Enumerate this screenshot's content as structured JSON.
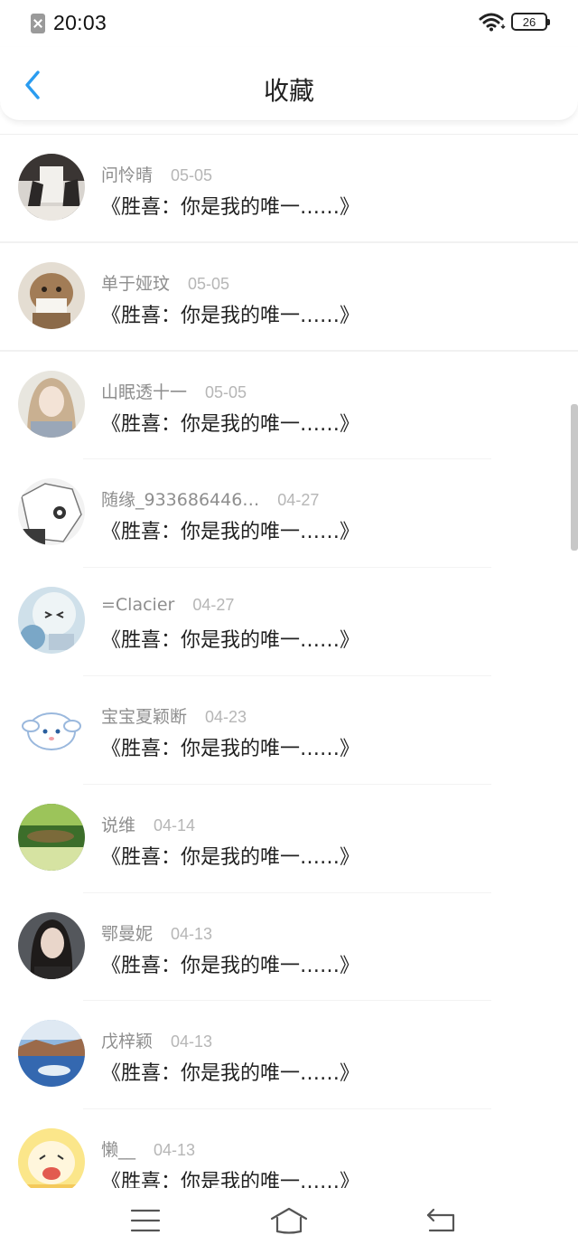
{
  "status_bar": {
    "time": "20:03",
    "battery": "26"
  },
  "header": {
    "title": "收藏",
    "back_icon": "chevron-left-icon",
    "accent_color": "#2a9cf0"
  },
  "favorites": [
    {
      "username": "问怜晴",
      "date": "05-05",
      "title": "《胜喜：你是我的唯一……》"
    },
    {
      "username": "单于娅玟",
      "date": "05-05",
      "title": "《胜喜：你是我的唯一……》"
    },
    {
      "username": "山眠透十一",
      "date": "05-05",
      "title": "《胜喜：你是我的唯一……》"
    },
    {
      "username": "随缘_933686446…",
      "date": "04-27",
      "title": "《胜喜：你是我的唯一……》"
    },
    {
      "username": "=Clacier",
      "date": "04-27",
      "title": "《胜喜：你是我的唯一……》"
    },
    {
      "username": "宝宝夏颖断",
      "date": "04-23",
      "title": "《胜喜：你是我的唯一……》"
    },
    {
      "username": "说维",
      "date": "04-14",
      "title": "《胜喜：你是我的唯一……》"
    },
    {
      "username": "鄂曼妮",
      "date": "04-13",
      "title": "《胜喜：你是我的唯一……》"
    },
    {
      "username": "戊梓颖",
      "date": "04-13",
      "title": "《胜喜：你是我的唯一……》"
    },
    {
      "username": "懒__",
      "date": "04-13",
      "title": "《胜喜：你是我的唯一……》"
    }
  ],
  "bottom_nav": {
    "menu_icon": "menu-icon",
    "home_icon": "home-icon",
    "back_icon": "back-icon"
  }
}
